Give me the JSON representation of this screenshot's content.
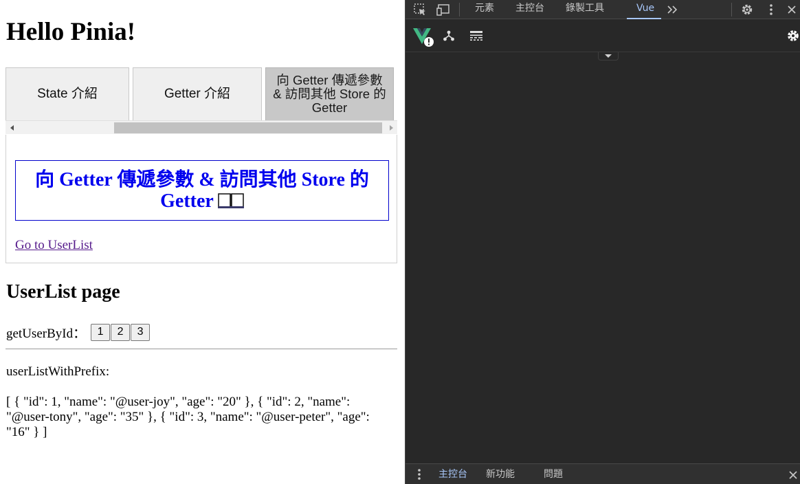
{
  "page": {
    "heading": "Hello Pinia!",
    "tabs": [
      {
        "label": "State 介紹"
      },
      {
        "label": "Getter 介紹"
      },
      {
        "label": "向 Getter 傳遞參數 & 訪問其他 Store 的 Getter"
      }
    ],
    "active_tab_index": 2,
    "panel": {
      "title": "向 Getter 傳遞參數 & 訪問其他 Store 的 Getter",
      "title_emoji": "book-icon",
      "link": "Go to UserList"
    },
    "userlist": {
      "heading": "UserList page",
      "get_label": "getUserById：",
      "buttons": [
        "1",
        "2",
        "3"
      ],
      "prefix_label": "userListWithPrefix:",
      "json_text": "[ { \"id\": 1, \"name\": \"@user-joy\", \"age\": \"20\" }, { \"id\": 2, \"name\": \"@user-tony\", \"age\": \"35\" }, { \"id\": 3, \"name\": \"@user-peter\", \"age\": \"16\" } ]"
    }
  },
  "devtools": {
    "tabs": [
      "元素",
      "主控台",
      "錄製工具",
      "Vue"
    ],
    "active_tab": "Vue",
    "drawer_tabs": [
      "主控台",
      "新功能",
      "問題"
    ],
    "active_drawer_tab": "主控台",
    "colors": {
      "accent": "#a8c7fa",
      "background": "#282828",
      "vue_green": "#42b883"
    }
  }
}
